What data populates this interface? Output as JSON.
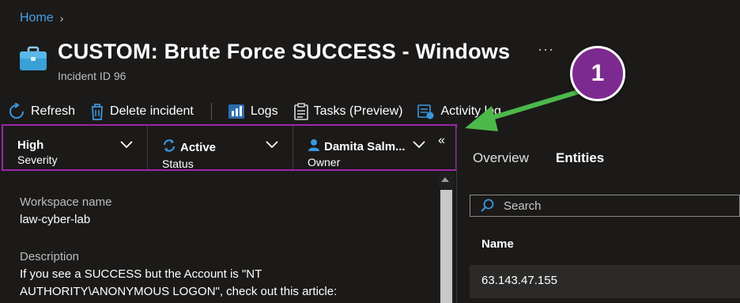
{
  "breadcrumb": {
    "home": "Home",
    "chevron": "›"
  },
  "header": {
    "title": "CUSTOM: Brute Force SUCCESS - Windows",
    "subtitle": "Incident ID 96",
    "more": "···"
  },
  "toolbar": {
    "refresh": "Refresh",
    "delete": "Delete incident",
    "logs": "Logs",
    "tasks": "Tasks (Preview)",
    "activity": "Activity log"
  },
  "status": {
    "severity": {
      "value": "High",
      "label": "Severity"
    },
    "status": {
      "value": "Active",
      "label": "Status"
    },
    "owner": {
      "value": "Damita Salm...",
      "label": "Owner"
    },
    "collapse": "«"
  },
  "details": {
    "workspace_label": "Workspace name",
    "workspace_value": "law-cyber-lab",
    "description_label": "Description",
    "description_line1": "If you see a SUCCESS but the Account is \"NT",
    "description_line2": "AUTHORITY\\ANONYMOUS LOGON\", check out this article:"
  },
  "right_pane": {
    "tabs": [
      "Overview",
      "Entities"
    ],
    "active_tab": "Entities",
    "search_placeholder": "Search",
    "column_header": "Name",
    "rows": [
      "63.143.47.155"
    ]
  },
  "callout": {
    "number": "1"
  },
  "colors": {
    "background": "#1b1a19",
    "link": "#4aa0e6",
    "highlight_border": "#9b27a8",
    "callout_fill": "#7c2a8f",
    "arrow": "#4cb84a",
    "active_icon": "#3a96dd"
  },
  "icons": {
    "title": "briefcase-icon",
    "refresh": "refresh-icon",
    "delete": "trash-icon",
    "logs": "logs-icon",
    "tasks": "tasks-icon",
    "activity": "activity-log-icon",
    "status": "sync-icon",
    "owner": "person-icon",
    "search": "search-icon"
  }
}
